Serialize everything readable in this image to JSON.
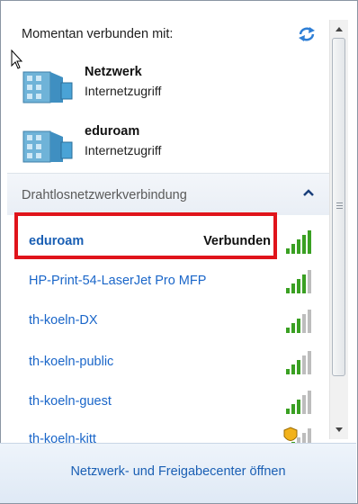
{
  "header": {
    "title": "Momentan verbunden mit:",
    "refresh_icon": "refresh-arrows-icon",
    "accent": "#1a66c9"
  },
  "connections": [
    {
      "name": "Netzwerk",
      "access": "Internetzugriff",
      "icon": "network-building-icon"
    },
    {
      "name": "eduroam",
      "access": "Internetzugriff",
      "icon": "network-building-icon"
    }
  ],
  "section": {
    "label": "Drahtlosnetzwerkverbindung",
    "collapse_icon": "chevron-up-icon"
  },
  "wifi_networks": [
    {
      "name": "eduroam",
      "status": "Verbunden",
      "signal_bars": 5,
      "secured_warning": false
    },
    {
      "name": "HP-Print-54-LaserJet Pro MFP",
      "status": "",
      "signal_bars": 4,
      "secured_warning": false
    },
    {
      "name": "th-koeln-DX",
      "status": "",
      "signal_bars": 3,
      "secured_warning": false
    },
    {
      "name": "th-koeln-public",
      "status": "",
      "signal_bars": 3,
      "secured_warning": false
    },
    {
      "name": "th-koeln-guest",
      "status": "",
      "signal_bars": 3,
      "secured_warning": false
    },
    {
      "name": "th-koeln-kitt",
      "status": "",
      "signal_bars": 2,
      "secured_warning": true
    }
  ],
  "highlight_color": "#e0141b",
  "footer": {
    "link": "Netzwerk- und Freigabecenter öffnen"
  }
}
